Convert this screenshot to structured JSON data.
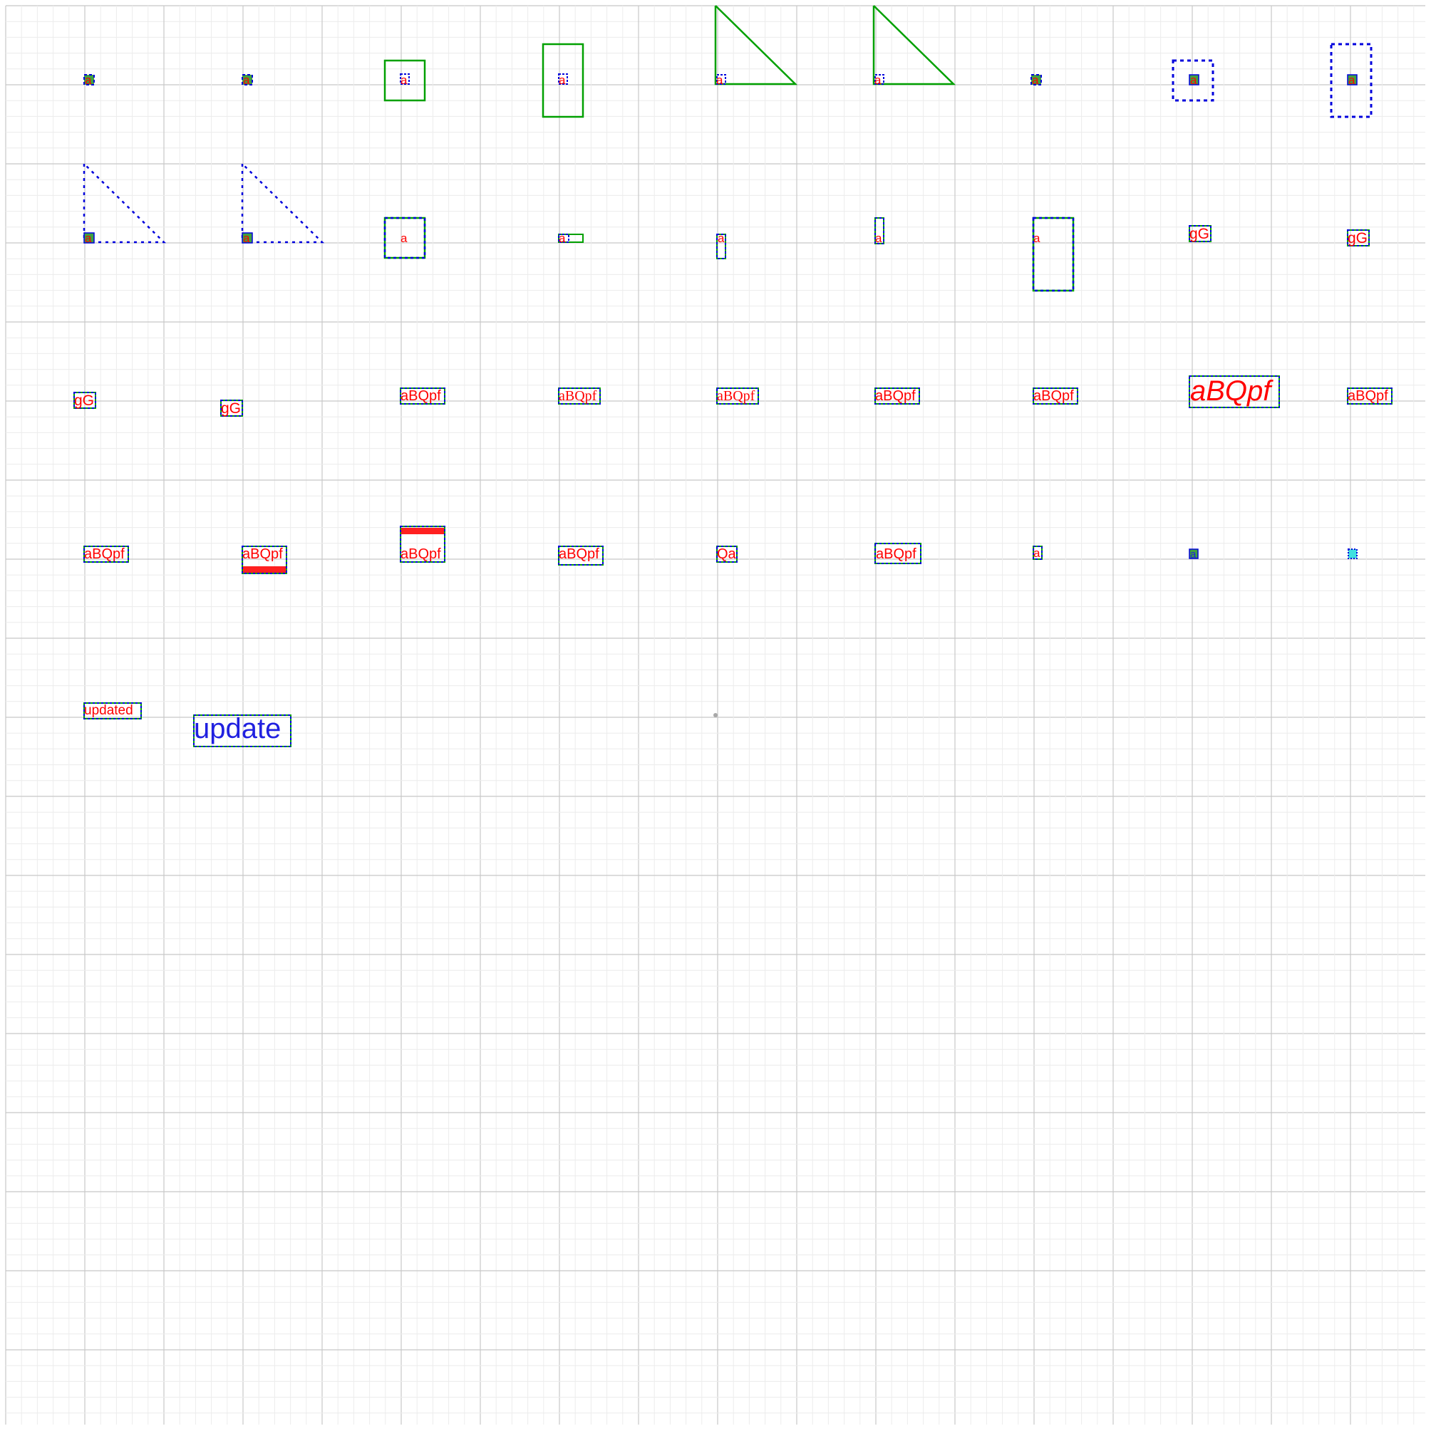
{
  "colors": {
    "text_red": "#ff0000",
    "text_blue": "#2020e0",
    "box_green": "#00a000",
    "box_blue": "#0000dd",
    "fill_green": "#40a040",
    "bar_red": "#ff2020",
    "cyan": "#40e0e0",
    "grid_major": "#c8c8c8",
    "grid_minor": "#ececec",
    "origin_dot": "#a8a8a8"
  },
  "row1": {
    "c1": "a",
    "c2": "a",
    "c3": "a",
    "c4": "a",
    "c5": "a",
    "c6": "a",
    "c7": "a",
    "c8": "a",
    "c9": "a"
  },
  "row2": {
    "c1": "a",
    "c2": "a",
    "c3": "a",
    "c4": "a",
    "c5": "a",
    "c6": "a",
    "c7": "a",
    "c8": "gG",
    "c9": "gG"
  },
  "row3": {
    "c1": "gG",
    "c2": "gG",
    "c3": "aBQpf",
    "c4": "aBQpf",
    "c5": "aBQpf",
    "c6": "aBQpf",
    "c7": "aBQpf",
    "c8": "aBQpf",
    "c9": "aBQpf"
  },
  "row4": {
    "c1": "aBQpf",
    "c2": "aBQpf",
    "c3": "aBQpf",
    "c4": "aBQpf",
    "c5": "Qa",
    "c6": "aBQpf",
    "c7": "a",
    "c8": "a"
  },
  "row5": {
    "c1": "updated",
    "c2": "update"
  }
}
